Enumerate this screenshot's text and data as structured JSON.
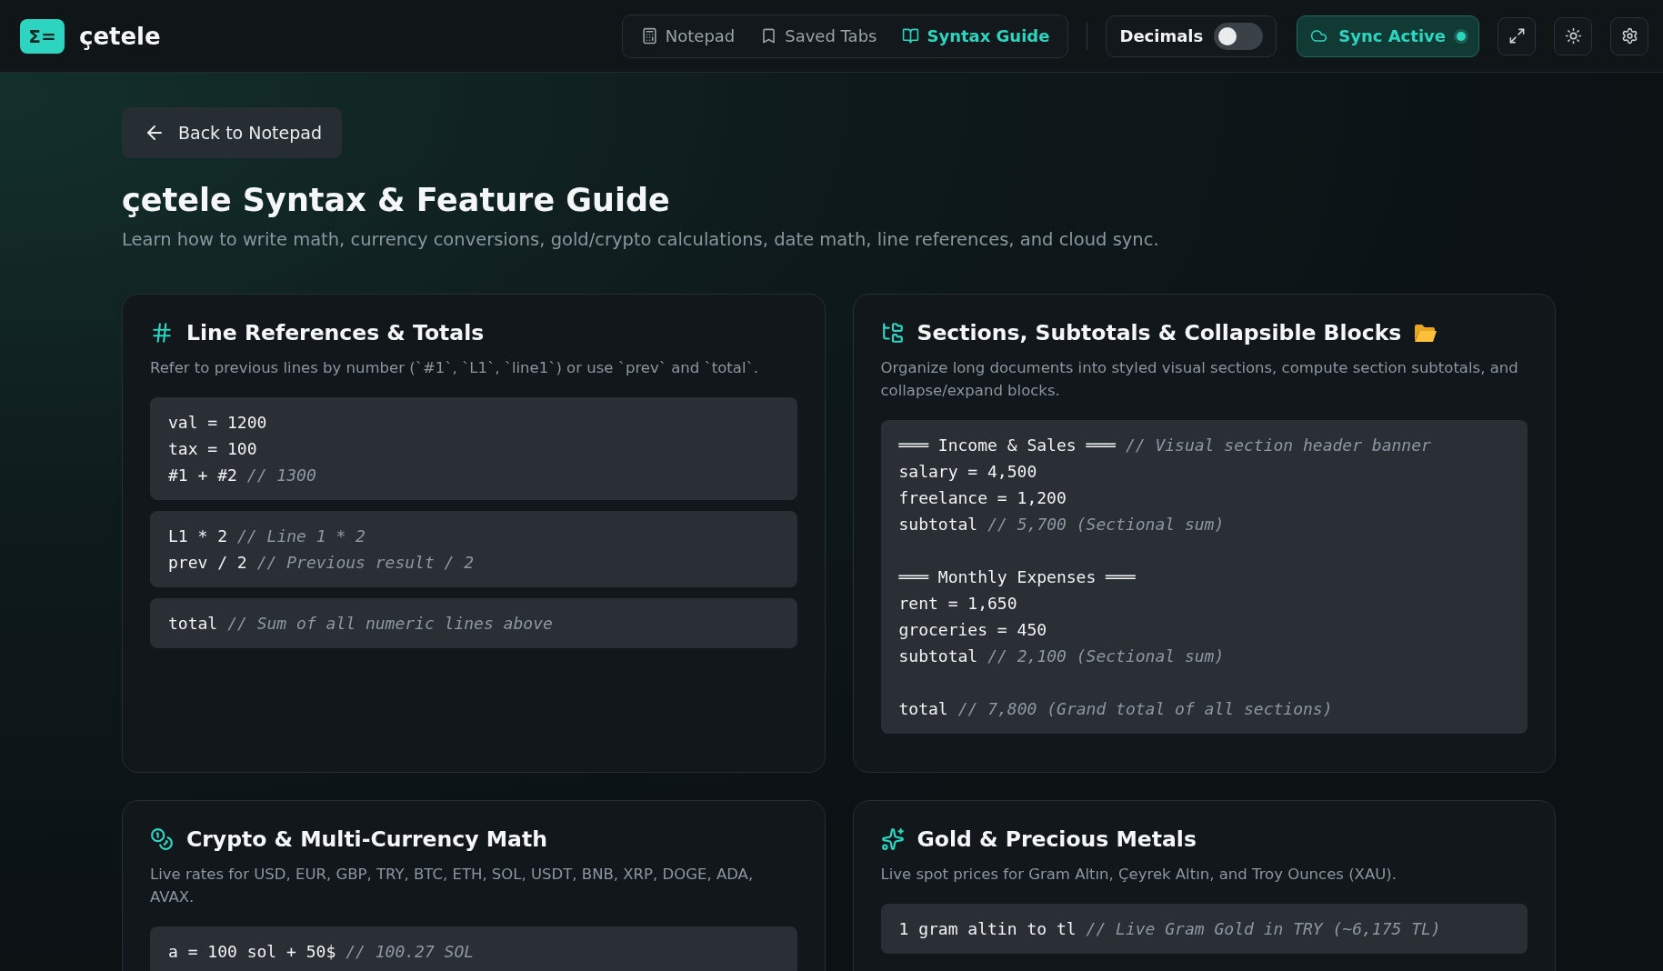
{
  "header": {
    "logo": "Σ=",
    "brand": "çetele",
    "nav": [
      {
        "label": "Notepad",
        "selected": false
      },
      {
        "label": "Saved Tabs",
        "selected": false
      },
      {
        "label": "Syntax Guide",
        "selected": true
      }
    ],
    "decimals": {
      "label": "Decimals",
      "on": false
    },
    "sync": {
      "label": "Sync Active",
      "on": true
    }
  },
  "back_button": "Back to Notepad",
  "title": "çetele Syntax & Feature Guide",
  "subtitle": "Learn how to write math, currency conversions, gold/crypto calculations, date math, line references, and cloud sync.",
  "cards": [
    {
      "title": "Line References & Totals",
      "description": "Refer to previous lines by number (`#1`, `L1`, `line1`) or use `prev` and `total`.",
      "blocks": [
        [
          [
            {
              "code": "val = 1200"
            },
            {
              "code": "tax = 100"
            },
            {
              "code": "#1 + #2",
              "comment": "// 1300"
            }
          ]
        ],
        [
          [
            {
              "code": "L1 * 2",
              "comment": "// Line 1 * 2"
            },
            {
              "code": "prev / 2",
              "comment": "// Previous result / 2"
            }
          ]
        ],
        [
          [
            {
              "code": "total",
              "comment": "// Sum of all numeric lines above"
            }
          ]
        ]
      ]
    },
    {
      "title": "Sections, Subtotals & Collapsible Blocks",
      "description": "Organize long documents into styled visual sections, compute section subtotals, and collapse/expand blocks.",
      "blocks": [
        [
          [
            {
              "code": "═══ Income & Sales ═══",
              "comment": "// Visual section header banner"
            },
            {
              "code": "salary = 4,500"
            },
            {
              "code": "freelance = 1,200"
            },
            {
              "code": "subtotal",
              "comment": "// 5,700 (Sectional sum)"
            }
          ],
          [
            {
              "code": "═══ Monthly Expenses ═══"
            },
            {
              "code": "rent = 1,650"
            },
            {
              "code": "groceries = 450"
            },
            {
              "code": "subtotal",
              "comment": "// 2,100 (Sectional sum)"
            }
          ],
          [
            {
              "code": "total",
              "comment": "// 7,800 (Grand total of all sections)"
            }
          ]
        ]
      ]
    },
    {
      "title": "Crypto & Multi-Currency Math",
      "description": "Live rates for USD, EUR, GBP, TRY, BTC, ETH, SOL, USDT, BNB, XRP, DOGE, ADA, AVAX.",
      "blocks": [
        [
          [
            {
              "code": "a = 100 sol + 50$",
              "comment": "// 100.27 SOL"
            }
          ]
        ]
      ]
    },
    {
      "title": "Gold & Precious Metals",
      "description": "Live spot prices for Gram Altın, Çeyrek Altın, and Troy Ounces (XAU).",
      "blocks": [
        [
          [
            {
              "code": "1 gram altin to tl",
              "comment": "// Live Gram Gold in TRY (~6,175 TL)"
            }
          ]
        ]
      ]
    }
  ]
}
